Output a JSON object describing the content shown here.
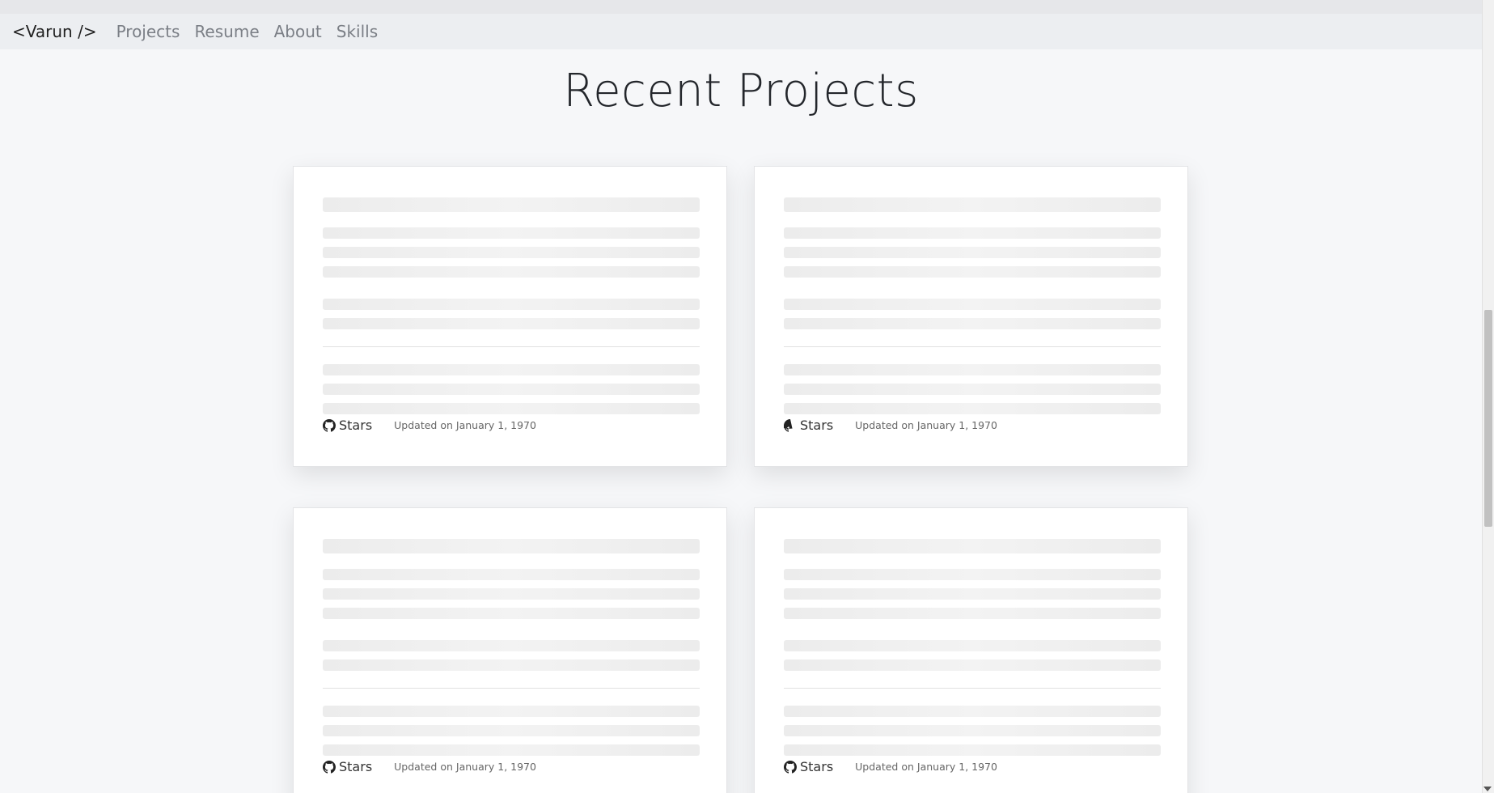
{
  "navbar": {
    "brand": "<Varun />",
    "links": [
      "Projects",
      "Resume",
      "About",
      "Skills"
    ]
  },
  "main": {
    "title": "Recent Projects",
    "cards": [
      {
        "stars_label": "Stars",
        "updated": "Updated on January 1, 1970"
      },
      {
        "stars_label": "Stars",
        "updated": "Updated on January 1, 1970"
      },
      {
        "stars_label": "Stars",
        "updated": "Updated on January 1, 1970"
      },
      {
        "stars_label": "Stars",
        "updated": "Updated on January 1, 1970"
      }
    ]
  },
  "icons": {
    "repo": "github-icon"
  },
  "colors": {
    "background": "#f6f7f9",
    "navbar": "#eceef1",
    "skeleton": "#ececec"
  }
}
